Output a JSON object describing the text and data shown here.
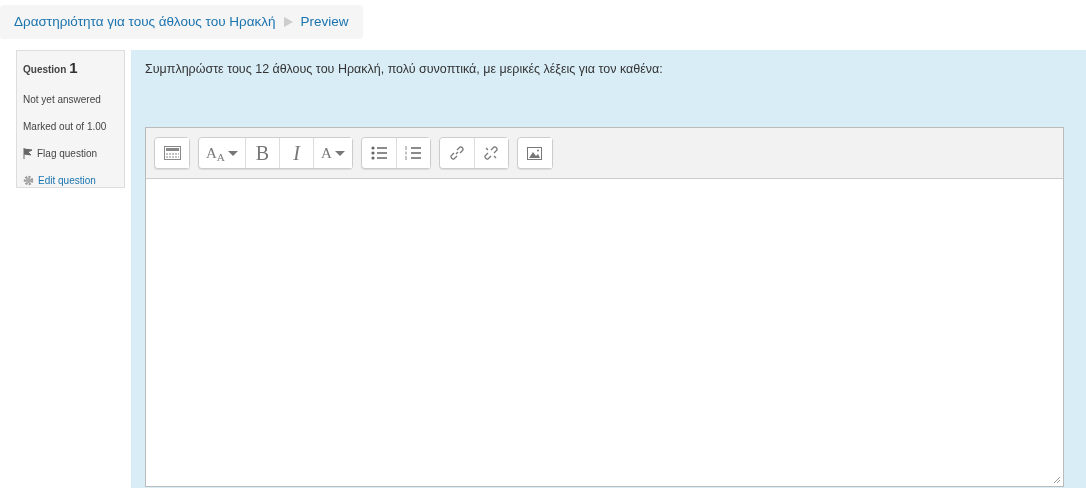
{
  "breadcrumb": [
    {
      "label": "Δραστηριότητα για τους άθλους του Ηρακλή"
    },
    {
      "label": "Preview"
    }
  ],
  "info": {
    "question_label": "Question",
    "question_number": "1",
    "status": "Not yet answered",
    "marks": "Marked out of 1.00",
    "actions": [
      {
        "kind": "flag",
        "label": "Flag question"
      },
      {
        "kind": "edit",
        "label": "Edit question"
      }
    ]
  },
  "question": {
    "text": "Συμπληρώστε τους 12 άθλους του Ηρακλή, πολύ συνοπτικά, με μερικές λέξεις για τον καθένα:"
  },
  "toolbar": [
    [
      {
        "kind": "html"
      }
    ],
    [
      {
        "kind": "style",
        "label": "A$_{A}$"
      },
      {
        "kind": "bold",
        "label": "B"
      },
      {
        "kind": "italic",
        "label": "I"
      },
      {
        "kind": "color",
        "label": "A"
      }
    ],
    [
      {
        "kind": "ul"
      },
      {
        "kind": "ol"
      }
    ],
    [
      {
        "kind": "link"
      },
      {
        "kind": "unlink"
      }
    ],
    [
      {
        "kind": "image"
      }
    ]
  ]
}
